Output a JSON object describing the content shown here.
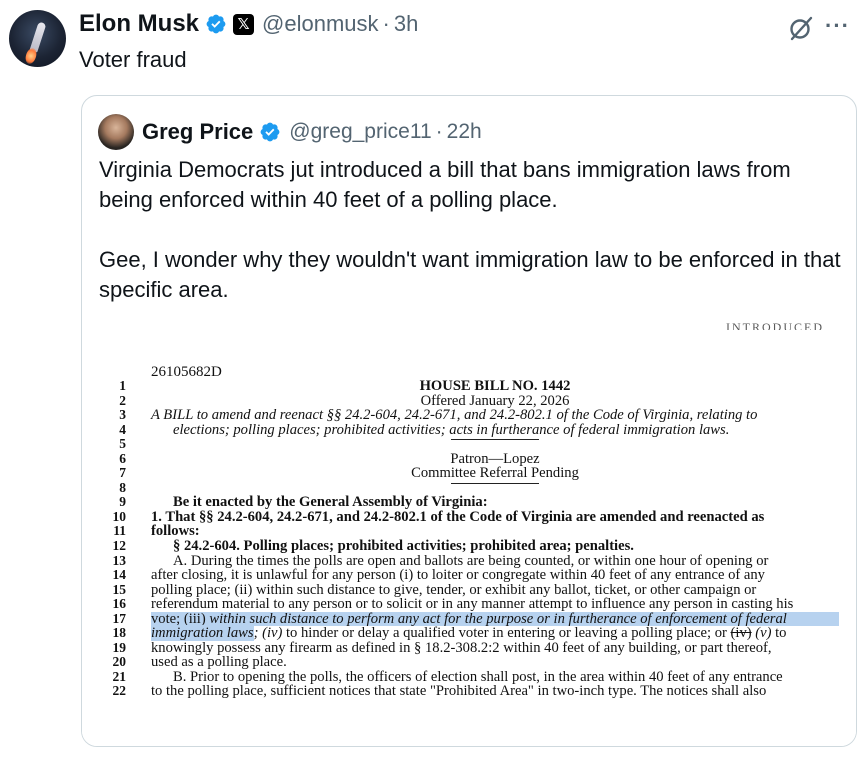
{
  "author": {
    "name": "Elon Musk",
    "handle": "@elonmusk",
    "separator": "·",
    "time": "3h",
    "text": "Voter fraud",
    "x_badge": "𝕏"
  },
  "icons": {
    "verified": "verified-badge-icon",
    "grok": "grok-icon",
    "more": "more-options-icon"
  },
  "more_label": "···",
  "quoted": {
    "name": "Greg Price",
    "handle": "@greg_price11",
    "separator": "·",
    "time": "22h",
    "paragraph1": "Virginia Democrats jut introduced a bill that bans immigration laws from being enforced within 40 feet of a polling place.",
    "paragraph2": "Gee, I wonder why they wouldn't want immigration law to be enforced in that specific area."
  },
  "document": {
    "top_mark": "INTRODUCED",
    "doc_id": "26105682D",
    "line_numbers": [
      "1",
      "2",
      "3",
      "4",
      "5",
      "6",
      "7",
      "8",
      "9",
      "10",
      "11",
      "12",
      "13",
      "14",
      "15",
      "16",
      "17",
      "18",
      "19",
      "20",
      "21",
      "22"
    ],
    "title": "HOUSE BILL NO. 1442",
    "offered": "Offered January 22, 2026",
    "bill_line1": "A BILL to amend and reenact §§ 24.2-604, 24.2-671, and 24.2-802.1 of the Code of Virginia, relating to",
    "bill_line2": "elections; polling places; prohibited activities; acts in furtherance of federal immigration laws.",
    "patron": "Patron—Lopez",
    "committee": "Committee Referral Pending",
    "enacted": "Be it enacted by the General Assembly of Virginia:",
    "line10": "1. That §§ 24.2-604, 24.2-671, and 24.2-802.1 of the Code of Virginia are amended and reenacted as",
    "line11": "follows:",
    "line12": "§ 24.2-604. Polling places; prohibited activities; prohibited area; penalties.",
    "line13": "A. During the times the polls are open and ballots are being counted, or within one hour of opening or",
    "line14": "after closing, it is unlawful for any person (i) to loiter or congregate within 40 feet of any entrance of any",
    "line15": "polling place; (ii) within such distance to give, tender, or exhibit any ballot, ticket, or other campaign or",
    "line16": "referendum material to any person or to solicit or in any manner attempt to influence any person in casting his",
    "line17a": "vote; (iii) ",
    "line17b": "within such distance to perform any act for the purpose or in furtherance of enforcement of federal",
    "line18a": "immigration laws",
    "line18b": "; (iv)",
    "line18c": " to hinder or delay a qualified voter in entering or leaving a polling place; or ",
    "line18d": "(iv)",
    "line18e": " (v)",
    "line18f": " to",
    "line19": "knowingly possess any firearm as defined in § 18.2-308.2:2 within 40 feet of any building, or part thereof,",
    "line20": "used as a polling place.",
    "line21": "B. Prior to opening the polls, the officers of election shall post, in the area within 40 feet of any entrance",
    "line22": "to the polling place, sufficient notices that state \"Prohibited Area\" in two-inch type. The notices shall also"
  }
}
